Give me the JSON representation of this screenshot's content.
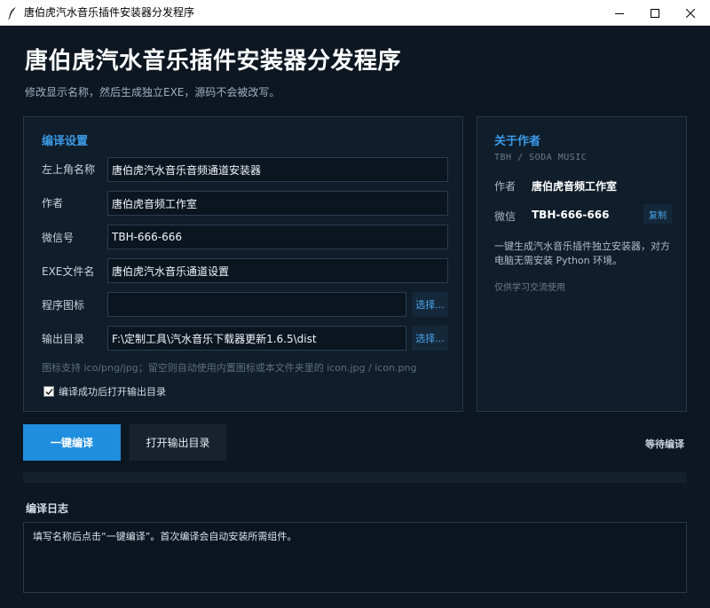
{
  "window": {
    "title": "唐伯虎汽水音乐插件安装器分发程序"
  },
  "header": {
    "title": "唐伯虎汽水音乐插件安装器分发程序",
    "subtitle": "修改显示名称，然后生成独立EXE，源码不会被改写。"
  },
  "compile_settings": {
    "section_title": "编译设置",
    "fields": [
      {
        "label": "左上角名称",
        "value": "唐伯虎汽水音乐音频通道安装器"
      },
      {
        "label": "作者",
        "value": "唐伯虎音频工作室"
      },
      {
        "label": "微信号",
        "value": "TBH-666-666"
      },
      {
        "label": "EXE文件名",
        "value": "唐伯虎汽水音乐通道设置"
      },
      {
        "label": "程序图标",
        "value": "",
        "button": "选择..."
      },
      {
        "label": "输出目录",
        "value": "F:\\定制工具\\汽水音乐下载器更新1.6.5\\dist",
        "button": "选择..."
      }
    ],
    "hint": "图标支持 ico/png/jpg；留空则自动使用内置图标或本文件夹里的 icon.jpg / icon.png",
    "open_after_compile": {
      "label": "编译成功后打开输出目录",
      "checked": true
    }
  },
  "about": {
    "section_title": "关于作者",
    "tagline": "TBH  /  SODA MUSIC",
    "author_label": "作者",
    "author_value": "唐伯虎音频工作室",
    "wechat_label": "微信",
    "wechat_value": "TBH-666-666",
    "copy_label": "复制",
    "description": "一键生成汽水音乐插件独立安装器，对方电脑无需安装 Python 环境。",
    "note": "仅供学习交流使用"
  },
  "actions": {
    "compile_label": "一键编译",
    "open_output_label": "打开输出目录",
    "status": "等待编译",
    "progress": 0
  },
  "log": {
    "title": "编译日志",
    "text": "填写名称后点击“一键编译”。首次编译会自动安装所需组件。"
  },
  "colors": {
    "background": "#0d1722",
    "panel": "#101d2a",
    "accent": "#1f8ede",
    "accent_text": "#3b9ae6"
  }
}
